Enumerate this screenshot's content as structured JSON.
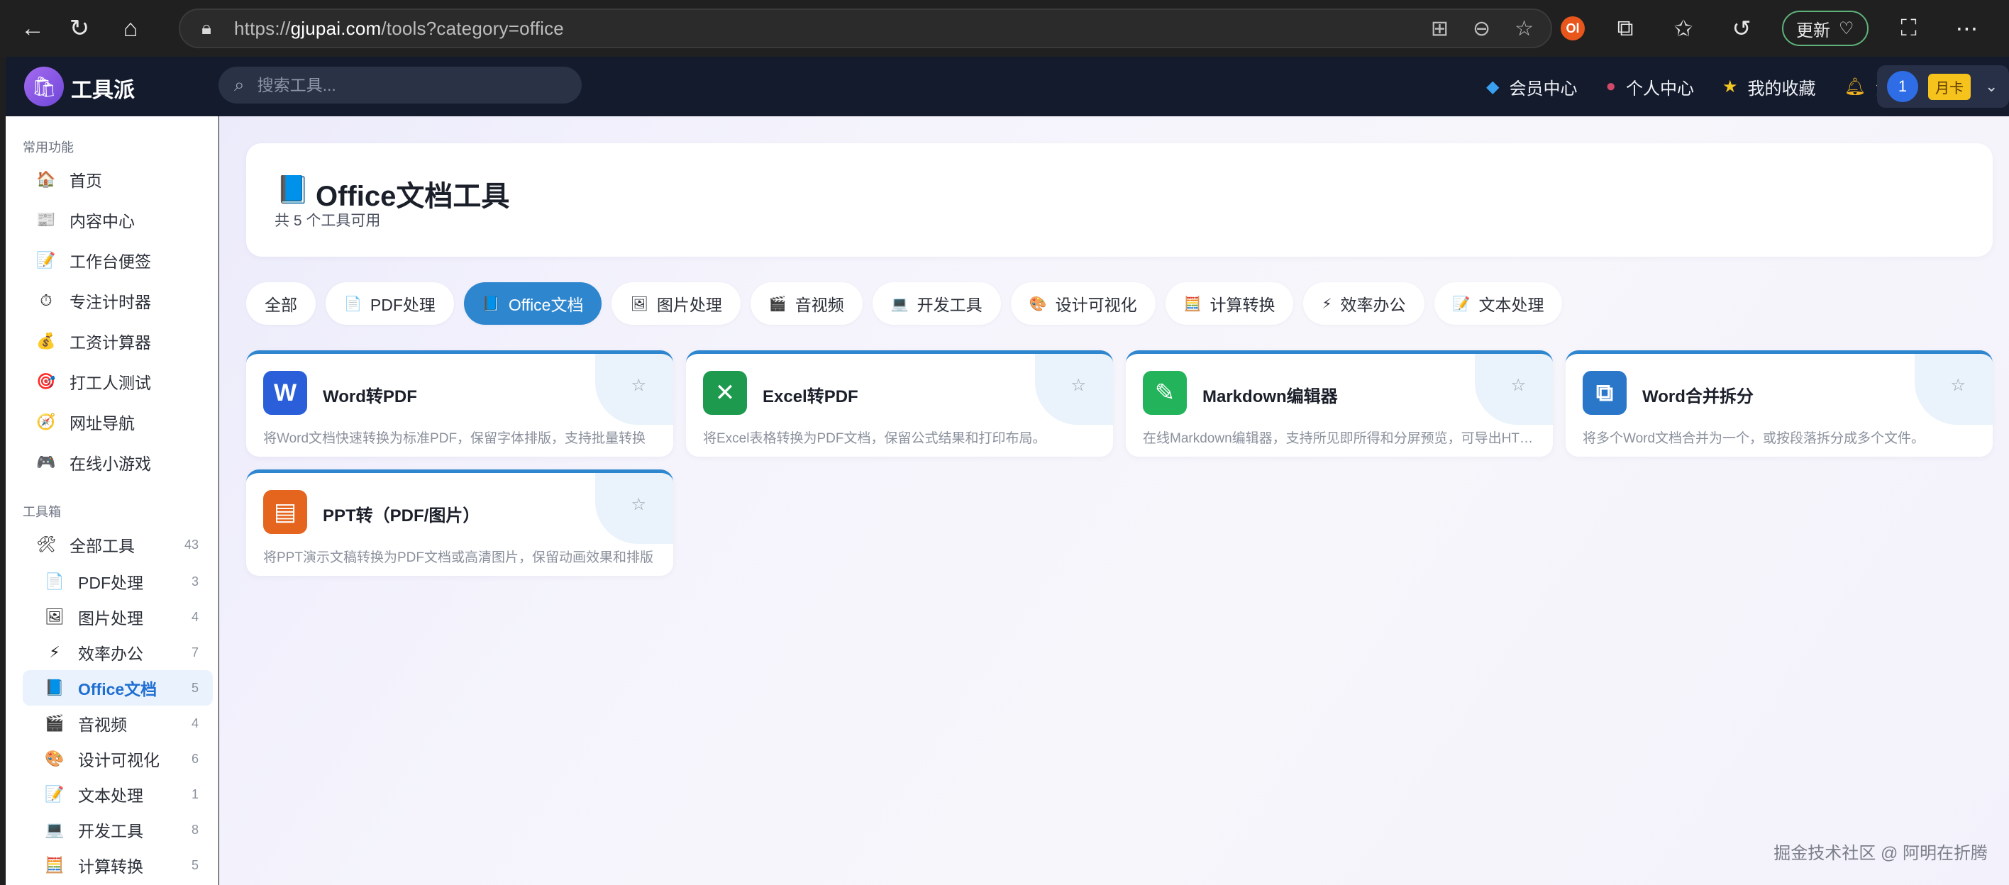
{
  "browser": {
    "url_prefix": "https://",
    "url_host": "gjupai.com",
    "url_path": "/tools?category=office",
    "update_label": "更新"
  },
  "header": {
    "logo_text": "工具派",
    "search_placeholder": "搜索工具...",
    "nav": [
      {
        "label": "会员中心",
        "icon": "diamond-icon"
      },
      {
        "label": "个人中心",
        "icon": "person-icon"
      },
      {
        "label": "我的收藏",
        "icon": "star-icon"
      },
      {
        "label": "消息",
        "icon": "bell-icon"
      }
    ],
    "user_avatar": "1",
    "month_badge": "月卡"
  },
  "sidebar": {
    "section_common": "常用功能",
    "common_items": [
      {
        "label": "首页",
        "icon": "🏠"
      },
      {
        "label": "内容中心",
        "icon": "📰"
      },
      {
        "label": "工作台便签",
        "icon": "📝"
      },
      {
        "label": "专注计时器",
        "icon": "⏱"
      },
      {
        "label": "工资计算器",
        "icon": "💰"
      },
      {
        "label": "打工人测试",
        "icon": "🎯"
      },
      {
        "label": "网址导航",
        "icon": "🧭"
      },
      {
        "label": "在线小游戏",
        "icon": "🎮"
      }
    ],
    "section_tools": "工具箱",
    "all_tools": {
      "label": "全部工具",
      "count": "43",
      "icon": "🛠"
    },
    "tool_items": [
      {
        "label": "PDF处理",
        "count": "3",
        "icon": "📄"
      },
      {
        "label": "图片处理",
        "count": "4",
        "icon": "🖼"
      },
      {
        "label": "效率办公",
        "count": "7",
        "icon": "⚡"
      },
      {
        "label": "Office文档",
        "count": "5",
        "icon": "📘"
      },
      {
        "label": "音视频",
        "count": "4",
        "icon": "🎬"
      },
      {
        "label": "设计可视化",
        "count": "6",
        "icon": "🎨"
      },
      {
        "label": "文本处理",
        "count": "1",
        "icon": "📝"
      },
      {
        "label": "开发工具",
        "count": "8",
        "icon": "💻"
      },
      {
        "label": "计算转换",
        "count": "5",
        "icon": "🧮"
      }
    ]
  },
  "main": {
    "title_icon": "📘",
    "title": "Office文档工具",
    "subtitle": "共 5 个工具可用",
    "tabs": [
      {
        "label": "全部",
        "icon": ""
      },
      {
        "label": "PDF处理",
        "icon": "📄"
      },
      {
        "label": "Office文档",
        "icon": "📘"
      },
      {
        "label": "图片处理",
        "icon": "🖼"
      },
      {
        "label": "音视频",
        "icon": "🎬"
      },
      {
        "label": "开发工具",
        "icon": "💻"
      },
      {
        "label": "设计可视化",
        "icon": "🎨"
      },
      {
        "label": "计算转换",
        "icon": "🧮"
      },
      {
        "label": "效率办公",
        "icon": "⚡"
      },
      {
        "label": "文本处理",
        "icon": "📝"
      }
    ],
    "active_tab": "Office文档",
    "cards": [
      {
        "name": "Word转PDF",
        "desc": "将Word文档快速转换为标准PDF，保留字体排版，支持批量转换",
        "icon_text": "W",
        "icon_color": "#2b5fd9"
      },
      {
        "name": "Excel转PDF",
        "desc": "将Excel表格转换为PDF文档，保留公式结果和打印布局。",
        "icon_text": "✕",
        "icon_color": "#1e9a4f"
      },
      {
        "name": "Markdown编辑器",
        "desc": "在线Markdown编辑器，支持所见即所得和分屏预览，可导出HTML",
        "icon_text": "✎",
        "icon_color": "#23b35a"
      },
      {
        "name": "Word合并拆分",
        "desc": "将多个Word文档合并为一个，或按段落拆分成多个文件。",
        "icon_text": "⧉",
        "icon_color": "#2a76c9"
      },
      {
        "name": "PPT转（PDF/图片）",
        "desc": "将PPT演示文稿转换为PDF文档或高清图片，保留动画效果和排版",
        "icon_text": "▤",
        "icon_color": "#e5651e"
      }
    ]
  },
  "watermark": "掘金技术社区 @ 阿明在折腾"
}
